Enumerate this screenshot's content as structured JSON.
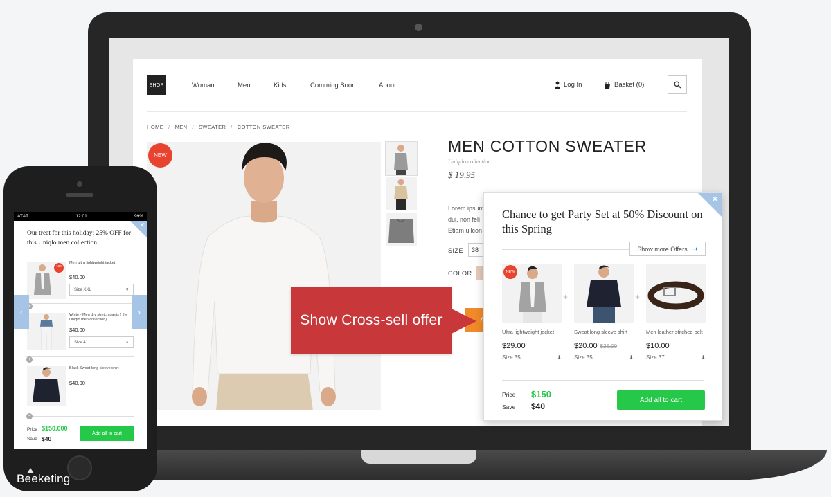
{
  "brand": {
    "watermark": "Beeketing"
  },
  "shop": {
    "logo": "SHOP",
    "nav": [
      "Woman",
      "Men",
      "Kids",
      "Comming Soon",
      "About"
    ],
    "login": "Log In",
    "basket": "Basket (0)",
    "breadcrumb": [
      "HOME",
      "MEN",
      "SWEATER",
      "COTTON SWEATER"
    ],
    "breadcrumb_sep": "/"
  },
  "product": {
    "badge": "NEW",
    "title": "MEN COTTON SWEATER",
    "collection": "Uniqilo collection",
    "price": "$ 19,95",
    "desc_lines": [
      "Lorem ipsum",
      "dui, non feli",
      "Etiam ullcon"
    ],
    "size_label": "SIZE",
    "size_value": "38",
    "color_label": "COLOR",
    "add_label": "ADD",
    "icons": [
      "user-icon",
      "basket-icon",
      "search-icon"
    ]
  },
  "callout": {
    "text": "Show Cross-sell offer"
  },
  "offer": {
    "close": "✕",
    "title": "Chance to get Party Set at 50% Discount on this Spring",
    "more_label": "Show more Offers",
    "more_arrow": "➞",
    "new_badge": "NEW",
    "plus": "+",
    "items": [
      {
        "name": "Ultra lightweight jacket",
        "price": "$29.00",
        "old_price": "",
        "size": "Size 35"
      },
      {
        "name": "Sweat long sleeve shirt",
        "price": "$20.00",
        "old_price": "$25.00",
        "size": "Size 35"
      },
      {
        "name": "Men leather stitched belt",
        "price": "$10.00",
        "old_price": "",
        "size": "Size 37"
      }
    ],
    "size_arrow": "⬍",
    "price_label": "Price",
    "price_value": "$150",
    "save_label": "Save",
    "save_value": "$40",
    "add_all_label": "Add all to cart",
    "colors": {
      "green": "#26c84a",
      "accent": "#a6c4e6",
      "callout": "#c8373a"
    }
  },
  "mobile": {
    "status": {
      "carrier": "AT&T",
      "time": "12:01",
      "battery": "99%"
    },
    "close": "✕",
    "title": "Our treat for this holiday: 25% OFF for this Uniqlo men collection",
    "badge": "-10%",
    "items": [
      {
        "name": "Men ultra lightweight jacket",
        "price": "$40.00",
        "size": "Size XXL"
      },
      {
        "name": "White - Men dry stretch pants ( the Uniqlo men collection)",
        "price": "$40.00",
        "size": "Size 41"
      },
      {
        "name": "Black Sweat long sleeve shirt",
        "price": "$40.00",
        "size": ""
      }
    ],
    "plus": "+",
    "minus": "−",
    "size_arrow": "⬍",
    "left_arrow": "‹",
    "right_arrow": "›",
    "price_label": "Price",
    "price_value": "$150.000",
    "save_label": "Save",
    "save_value": "$40",
    "add_all_label": "Add all to cart"
  }
}
